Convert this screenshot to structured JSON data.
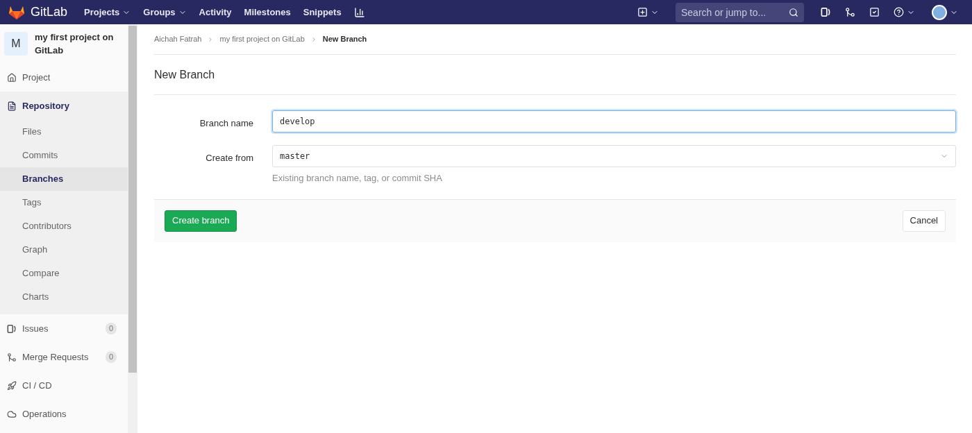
{
  "navbar": {
    "brand": "GitLab",
    "menu": [
      {
        "label": "Projects",
        "dropdown": true
      },
      {
        "label": "Groups",
        "dropdown": true
      },
      {
        "label": "Activity",
        "dropdown": false
      },
      {
        "label": "Milestones",
        "dropdown": false
      },
      {
        "label": "Snippets",
        "dropdown": false
      }
    ],
    "search": {
      "placeholder": "Search or jump to..."
    }
  },
  "sidebar": {
    "project": {
      "avatar": "M",
      "name": "my first project on GitLab"
    },
    "items": [
      {
        "label": "Project",
        "selected": false
      },
      {
        "label": "Repository",
        "selected": true,
        "children": [
          {
            "label": "Files",
            "selected": false
          },
          {
            "label": "Commits",
            "selected": false
          },
          {
            "label": "Branches",
            "selected": true
          },
          {
            "label": "Tags",
            "selected": false
          },
          {
            "label": "Contributors",
            "selected": false
          },
          {
            "label": "Graph",
            "selected": false
          },
          {
            "label": "Compare",
            "selected": false
          },
          {
            "label": "Charts",
            "selected": false
          }
        ]
      },
      {
        "label": "Issues",
        "selected": false,
        "count": "0"
      },
      {
        "label": "Merge Requests",
        "selected": false,
        "count": "0"
      },
      {
        "label": "CI / CD",
        "selected": false
      },
      {
        "label": "Operations",
        "selected": false
      }
    ]
  },
  "breadcrumbs": [
    {
      "label": "Aichah Fatrah",
      "current": false
    },
    {
      "label": "my first project on GitLab",
      "current": false
    },
    {
      "label": "New Branch",
      "current": true
    }
  ],
  "page_title": "New Branch",
  "form": {
    "fields": [
      {
        "label": "Branch name",
        "kind": "text",
        "value": "develop",
        "focused": true
      },
      {
        "label": "Create from",
        "kind": "select",
        "value": "master",
        "focused": false,
        "hint": "Existing branch name, tag, or commit SHA"
      }
    ],
    "submit": "Create branch",
    "cancel": "Cancel"
  }
}
